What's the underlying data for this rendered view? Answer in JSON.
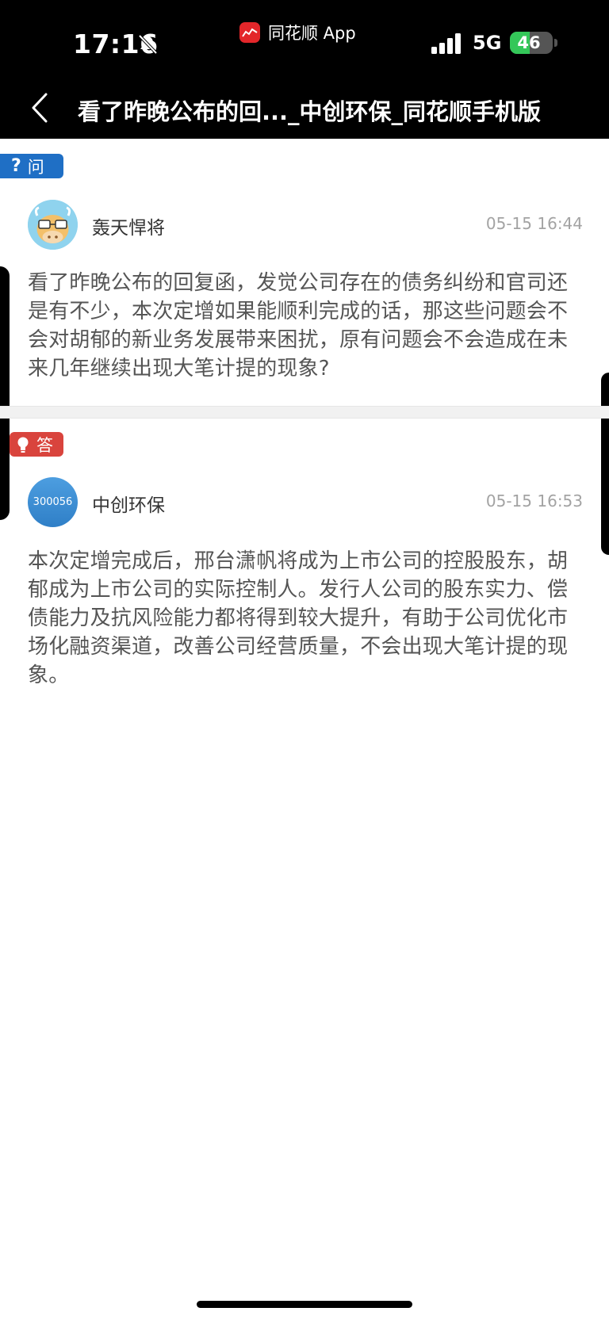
{
  "status_bar": {
    "time": "17:16",
    "app_name": "同花顺 App",
    "network": "5G",
    "battery": "46",
    "battery_level": 0.46
  },
  "nav": {
    "title": "看了昨晚公布的回..._中创环保_同花顺手机版"
  },
  "question": {
    "badge_label": "问",
    "author": "轰天悍将",
    "time": "05-15 16:44",
    "body": "看了昨晚公布的回复函，发觉公司存在的债务纠纷和官司还是有不少，本次定增如果能顺利完成的话，那这些问题会不会对胡郁的新业务发展带来困扰，原有问题会不会造成在未来几年继续出现大笔计提的现象?"
  },
  "answer": {
    "badge_label": "答",
    "author": "中创环保",
    "avatar_label": "300056",
    "time": "05-15 16:53",
    "body": "本次定增完成后，邢台潇帆将成为上市公司的控股股东，胡郁成为上市公司的实际控制人。发行人公司的股东实力、偿债能力及抗风险能力都将得到较大提升，有助于公司优化市场化融资渠道，改善公司经营质量，不会出现大笔计提的现象。"
  },
  "colors": {
    "question_badge": "#1f6fc5",
    "answer_badge": "#d9443d",
    "body_text": "#555555",
    "time_text": "#a3a3a3"
  }
}
